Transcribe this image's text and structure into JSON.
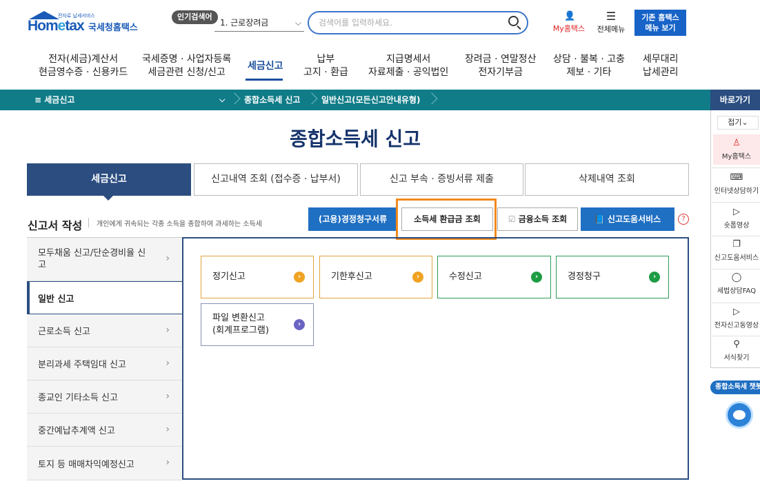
{
  "header": {
    "logo_text": "Hometax",
    "logo_tagline": "전자로 납세서비스",
    "logo_kr": "국세청홈택스",
    "popular_label": "인기검색어",
    "popular_selected": "1.  근로장려금",
    "search_placeholder": "검색어를 입력하세요.",
    "my_hometax": "My홈택스",
    "all_menu": "전체메뉴",
    "old_site_line1": "기존 홈택스",
    "old_site_line2": "메뉴 보기"
  },
  "gnb": [
    {
      "l1": "전자(세금)계산서",
      "l2": "현금영수증 · 신용카드"
    },
    {
      "l1": "국세증명 · 사업자등록",
      "l2": "세금관련 신청/신고"
    },
    {
      "l1": "세금신고",
      "l2": ""
    },
    {
      "l1": "납부",
      "l2": "고지 · 환급"
    },
    {
      "l1": "지급명세서",
      "l2": "자료제출 · 공익법인"
    },
    {
      "l1": "장려금 · 연말정산",
      "l2": "전자기부금"
    },
    {
      "l1": "상담 · 불복 · 고충",
      "l2": "제보 · 기타"
    },
    {
      "l1": "세무대리",
      "l2": "납세관리"
    }
  ],
  "breadcrumb": {
    "menu": "≡  세금신고",
    "level2": "종합소득세 신고",
    "level3": "일반신고(모든신고안내유형)"
  },
  "page_title": "종합소득세 신고",
  "tabs": [
    "세금신고",
    "신고내역 조회 (접수증 · 납부서)",
    "신고 부속 · 증빙서류 제출",
    "삭제내역 조회"
  ],
  "section": {
    "title": "신고서 작성",
    "desc": "개인에게 귀속되는 각종 소득을 종합하여 과세하는 소득세"
  },
  "buttons": {
    "claim_docs": "(고용)경정청구서류",
    "refund_lookup": "소득세 환급금 조회",
    "financial_income": "금융소득 조회",
    "help_service": "신고도움서비스",
    "help_icon": "?"
  },
  "left_menu": [
    "모두채움 신고/단순경비율 신고",
    "일반 신고",
    "근로소득 신고",
    "분리과세 주택임대 신고",
    "종교인 기타소득 신고",
    "중간예납추계액 신고",
    "토지 등 매매차익예정신고"
  ],
  "cards": [
    {
      "label": "정기신고",
      "arrow": "›"
    },
    {
      "label": "기한후신고",
      "arrow": "›"
    },
    {
      "label": "수정신고",
      "arrow": "›"
    },
    {
      "label": "경정청구",
      "arrow": "›"
    },
    {
      "label1": "파일 변환신고",
      "label2": "(회계프로그램)",
      "arrow": "›"
    }
  ],
  "quick": {
    "header": "바로가기",
    "fold": "접기",
    "items": [
      "My홈택스",
      "인터넷상담하기",
      "숏폼영상",
      "신고도움서비스",
      "세법상담FAQ",
      "전자신고동영상",
      "서식찾기"
    ],
    "chatbot": "종합소득세 챗봇"
  },
  "colors": {
    "brand": "#1a5bb8",
    "teal_bar": "#0f7c88",
    "navy": "#2b4d80",
    "highlight": "#f08a1c",
    "orange_dot": "#f0a322",
    "green_dot": "#1e9c44",
    "purple_dot": "#6a63c4"
  }
}
